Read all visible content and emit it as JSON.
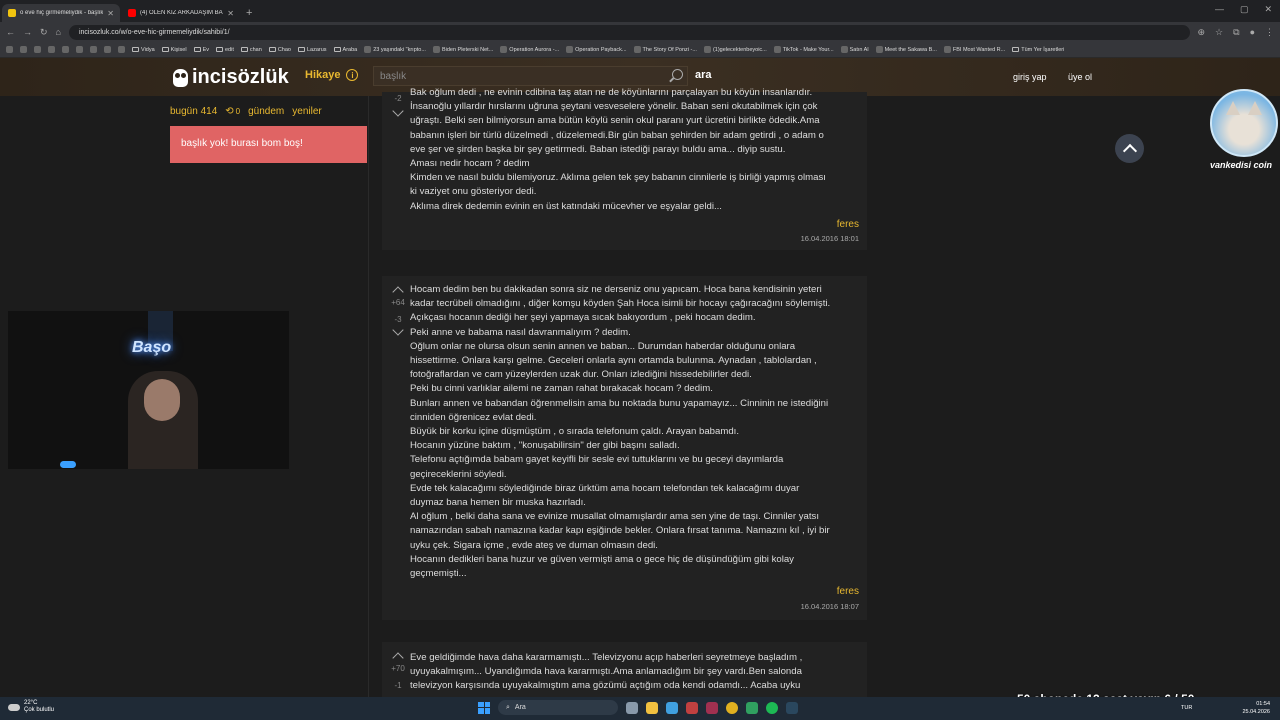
{
  "browser": {
    "tabs": [
      {
        "label": "o eve hiç girmemeliydik - başlık",
        "active": true,
        "fav_color": "#f1c40f"
      },
      {
        "label": "(4) ÖLEN KIZ ARKADAŞIM BANA",
        "active": false,
        "fav_color": "#ff0000"
      }
    ],
    "url": "incisozluk.co/w/o-eve-hic-girmemeliydik/sahibi/1/",
    "bookmarks": [
      {
        "label": "Vidya",
        "folder": true
      },
      {
        "label": "Kişisel",
        "folder": true
      },
      {
        "label": "Ev",
        "folder": true
      },
      {
        "label": "edit",
        "folder": true
      },
      {
        "label": "chan",
        "folder": true
      },
      {
        "label": "Chao",
        "folder": true
      },
      {
        "label": "Lazarus",
        "folder": true
      },
      {
        "label": "Araba",
        "folder": true
      },
      {
        "label": "23 yaşındaki \"krıpto...",
        "folder": false
      },
      {
        "label": "Biden Pleterski Net...",
        "folder": false
      },
      {
        "label": "Operation Aurora -...",
        "folder": false
      },
      {
        "label": "Operation Payback...",
        "folder": false
      },
      {
        "label": "The Story Of Ponzi -...",
        "folder": false
      },
      {
        "label": "(1)gelecektenbeyoic...",
        "folder": false
      },
      {
        "label": "TikTok - Make Your...",
        "folder": false
      },
      {
        "label": "Satın Al",
        "folder": false
      },
      {
        "label": "Meet the Sakawa B...",
        "folder": false
      },
      {
        "label": "FBI Most Wanted R...",
        "folder": false
      },
      {
        "label": "Tüm Yer İşaretleri",
        "folder": true
      }
    ]
  },
  "site": {
    "logo": "incisözlük",
    "hikaye": "Hikaye",
    "search_placeholder": "başlık",
    "search_button": "ara",
    "login": "giriş yap",
    "register": "üye ol"
  },
  "sidebar": {
    "today": "bugün 414",
    "spark_count": "0",
    "gundem": "gündem",
    "yeniler": "yeniler",
    "empty_message": "başlık yok! burası bom boş!"
  },
  "entries": [
    {
      "votes_up": "",
      "votes_down": "-2",
      "lines": [
        "Bak oğlum dedi , ne evinin cdibina taş atan ne de köyünlarını parçalayan bu köyün insanlarıdır.",
        "İnsanoğlu yıllardır hırslarını uğruna şeytani vesveselere yönelir. Baban seni okutabilmek için çok",
        "uğraştı. Belki sen bilmiyorsun ama bütün köylü senin okul paranı yurt ücretini birlikte ödedik.Ama",
        "babanın işleri bir türlü düzelmedi , düzelemedi.Bir gün baban şehirden bir adam getirdi , o adam o",
        "eve şer ve şirden başka bir şey getirmedi. Baban istediği parayı buldu ama... diyip sustu.",
        "Aması nedir hocam ? dedim",
        "Kimden ve nasıl buldu bilemiyoruz. Aklıma gelen tek şey babanın cinnilerle iş birliği yapmış olması",
        "ki vaziyet onu gösteriyor dedi.",
        "Aklıma direk dedemin evinin en üst katındaki mücevher ve eşyalar geldi..."
      ],
      "author": "feres",
      "date": "16.04.2016 18:01"
    },
    {
      "votes_up": "+64",
      "votes_down": "-3",
      "lines": [
        "Hocam dedim ben bu dakikadan sonra siz ne derseniz onu yapıcam. Hoca bana kendisinin yeteri",
        "kadar tecrübeli olmadığını , diğer komşu köyden Şah Hoca isimli bir hocayı çağıracağını söylemişti.",
        "Açıkçası hocanın dediği her şeyi yapmaya sıcak bakıyordum , peki hocam dedim.",
        "Peki anne ve babama nasıl davranmalıyım ? dedim.",
        "Oğlum onlar ne olursa olsun senin annen ve baban... Durumdan haberdar olduğunu onlara",
        "hissettirme. Onlara karşı gelme. Geceleri onlarla aynı ortamda bulunma. Aynadan , tablolardan ,",
        "fotoğraflardan ve cam yüzeylerden uzak dur. Onları izlediğini hissedebilirler dedi.",
        "Peki bu cinni varlıklar ailemi ne zaman rahat bırakacak hocam ? dedim.",
        "Bunları annen ve babandan öğrenmelisin ama bu noktada bunu yapamayız... Cinninin ne istediğini",
        "cinniden öğrenicez evlat dedi.",
        "Büyük bir korku içine düşmüştüm , o sırada telefonum çaldı. Arayan babamdı.",
        "Hocanın yüzüne baktım , \"konuşabilirsin\" der gibi başını salladı.",
        "Telefonu açtığımda babam gayet keyifli bir sesle evi tuttuklarını ve bu geceyi dayımlarda",
        "geçireceklerini söyledi.",
        "Evde tek kalacağımı söylediğinde biraz ürktüm ama hocam telefondan tek kalacağımı duyar",
        "duymaz bana hemen bir muska hazırladı.",
        "Al oğlum , belki daha sana ve evinize musallat olmamışlardır ama sen yine de taşı. Cinniler yatsı",
        "namazından sabah namazına kadar kapı eşiğinde bekler. Onlara fırsat tanıma. Namazını kıl , iyi bir",
        "uyku çek. Sigara içme , evde ateş ve duman olmasın dedi.",
        "Hocanın dedikleri bana huzur ve güven vermişti ama o gece hiç de düşündüğüm gibi kolay",
        "geçmemişti..."
      ],
      "author": "feres",
      "date": "16.04.2016 18:07"
    },
    {
      "votes_up": "+70",
      "votes_down": "-1",
      "lines": [
        "Eve geldiğimde hava daha kararmamıştı... Televizyonu açıp haberleri seyretmeye başladım ,",
        "uyuyakalmışım... Uyandığımda hava kararmıştı.Ama anlamadığım bir şey vardı.Ben salonda",
        "televizyon karşısında uyuyakalmıştım ama gözümü açtığım oda kendi odamdı... Acaba uyku"
      ],
      "author": "",
      "date": ""
    }
  ],
  "overlay": {
    "neon_sign": "Başo",
    "cat_name": "vankedisi coin",
    "stream_goal": "50 abonede 12 saat yayın 6 / 50"
  },
  "taskbar": {
    "temperature": "22°C",
    "weather": "Çok bulutlu",
    "search": "Ara",
    "lang": "TUR",
    "time": "01:54",
    "date": "25.04.2026"
  }
}
